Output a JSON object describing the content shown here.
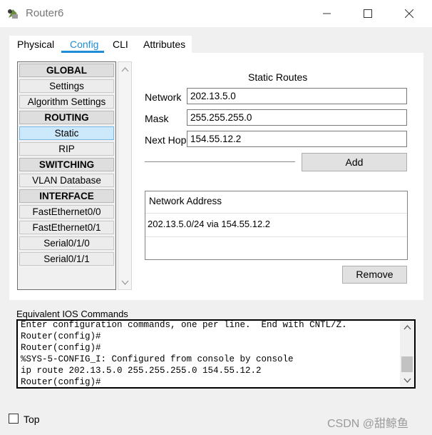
{
  "window": {
    "title": "Router6"
  },
  "tabs": [
    {
      "label": "Physical"
    },
    {
      "label": "Config"
    },
    {
      "label": "CLI"
    },
    {
      "label": "Attributes"
    }
  ],
  "sidebar": {
    "items": [
      {
        "label": "GLOBAL"
      },
      {
        "label": "Settings"
      },
      {
        "label": "Algorithm Settings"
      },
      {
        "label": "ROUTING"
      },
      {
        "label": "Static"
      },
      {
        "label": "RIP"
      },
      {
        "label": "SWITCHING"
      },
      {
        "label": "VLAN Database"
      },
      {
        "label": "INTERFACE"
      },
      {
        "label": "FastEthernet0/0"
      },
      {
        "label": "FastEthernet0/1"
      },
      {
        "label": "Serial0/1/0"
      },
      {
        "label": "Serial0/1/1"
      }
    ]
  },
  "static_routes": {
    "heading": "Static Routes",
    "network_label": "Network",
    "network_value": "202.13.5.0",
    "mask_label": "Mask",
    "mask_value": "255.255.255.0",
    "nexthop_label": "Next Hop",
    "nexthop_value": "154.55.12.2",
    "add_label": "Add",
    "list_header": "Network Address",
    "routes": [
      "202.13.5.0/24 via 154.55.12.2"
    ],
    "remove_label": "Remove"
  },
  "ios": {
    "label": "Equivalent IOS Commands",
    "lines": [
      "Enter configuration commands, one per line.  End with CNTL/Z.",
      "Router(config)#",
      "Router(config)#",
      "%SYS-5-CONFIG_I: Configured from console by console",
      "ip route 202.13.5.0 255.255.255.0 154.55.12.2",
      "Router(config)#"
    ]
  },
  "footer": {
    "top_label": "Top",
    "top_checked": false,
    "watermark": "CSDN @甜鲸鱼"
  },
  "colors": {
    "accent": "#1f8dd6",
    "selected_bg": "#cce8fb"
  }
}
